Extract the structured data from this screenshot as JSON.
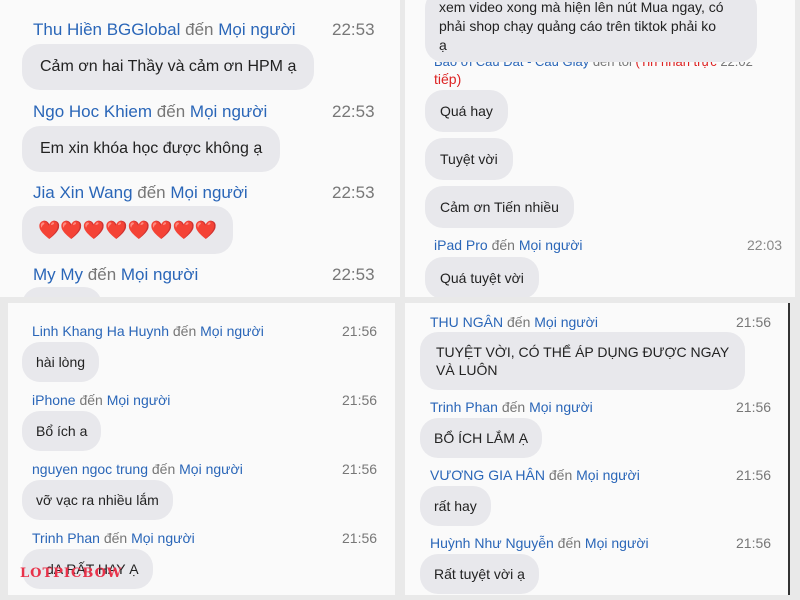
{
  "panel_top_left": {
    "messages": [
      {
        "sender": "Thu Hiền BGGlobal",
        "to": "đến",
        "recipient": "Mọi người",
        "time": "22:53",
        "text": "Cảm ơn hai Thầy và cảm ơn HPM ạ"
      },
      {
        "sender": "Ngo Hoc Khiem",
        "to": "đến",
        "recipient": "Mọi người",
        "time": "22:53",
        "text": "Em xin khóa học được không ạ"
      },
      {
        "sender": "Jia Xin Wang",
        "to": "đến",
        "recipient": "Mọi người",
        "time": "22:53",
        "text": "❤️❤️❤️❤️❤️❤️❤️❤️"
      },
      {
        "sender": "My My",
        "to": "đến",
        "recipient": "Mọi người",
        "time": "22:53",
        "text": ""
      }
    ]
  },
  "panel_top_right": {
    "first_bubble": [
      "xem video xong mà hiện lên nút Mua ngay, có",
      "phải shop chạy quảng cáo trên tiktok phải ko",
      "ạ"
    ],
    "dm_header": {
      "sender": "Bảo ơi Cầu Đất - Cầu Giấy",
      "to": "đến tôi",
      "note": "(Tin nhắn trực",
      "note2": "tiếp)",
      "time": "22:02"
    },
    "bubbles": [
      "Quá hay",
      "Tuyệt vời",
      "Cảm ơn Tiến nhiều"
    ],
    "last": {
      "sender": "iPad Pro",
      "to": "đến",
      "recipient": "Mọi người",
      "time": "22:03",
      "text": "Quá tuyệt vời"
    }
  },
  "panel_bottom_left": {
    "messages": [
      {
        "sender": "Linh Khang Ha Huynh",
        "to": "đến",
        "recipient": "Mọi người",
        "time": "21:56",
        "text": "hài lòng"
      },
      {
        "sender": "iPhone",
        "to": "đến",
        "recipient": "Mọi người",
        "time": "21:56",
        "text": "Bổ ích a"
      },
      {
        "sender": "nguyen ngoc trung",
        "to": "đến",
        "recipient": "Mọi người",
        "time": "21:56",
        "text": "vỡ vạc ra nhiều lắm"
      },
      {
        "sender": "Trinh Phan",
        "to": "đến",
        "recipient": "Mọi người",
        "time": "21:56",
        "text": "dA RẤT HAY Ạ"
      }
    ]
  },
  "panel_bottom_right": {
    "messages": [
      {
        "sender": "THU NGÂN",
        "to": "đến",
        "recipient": "Mọi người",
        "time": "21:56",
        "text": "TUYỆT VỜI, CÓ THỂ ÁP DỤNG ĐƯỢC NGAY",
        "text2": "VÀ LUÔN"
      },
      {
        "sender": "Trinh Phan",
        "to": "đến",
        "recipient": "Mọi người",
        "time": "21:56",
        "text": "BỔ ÍCH LẮM Ạ"
      },
      {
        "sender": "VƯƠNG GIA HÂN",
        "to": "đến",
        "recipient": "Mọi người",
        "time": "21:56",
        "text": "rất hay"
      },
      {
        "sender": "Huỳnh Như Nguyễn",
        "to": "đến",
        "recipient": "Mọi người",
        "time": "21:56",
        "text": "Rất tuyệt vời ạ"
      }
    ]
  },
  "watermark": "LOTPICBOW"
}
